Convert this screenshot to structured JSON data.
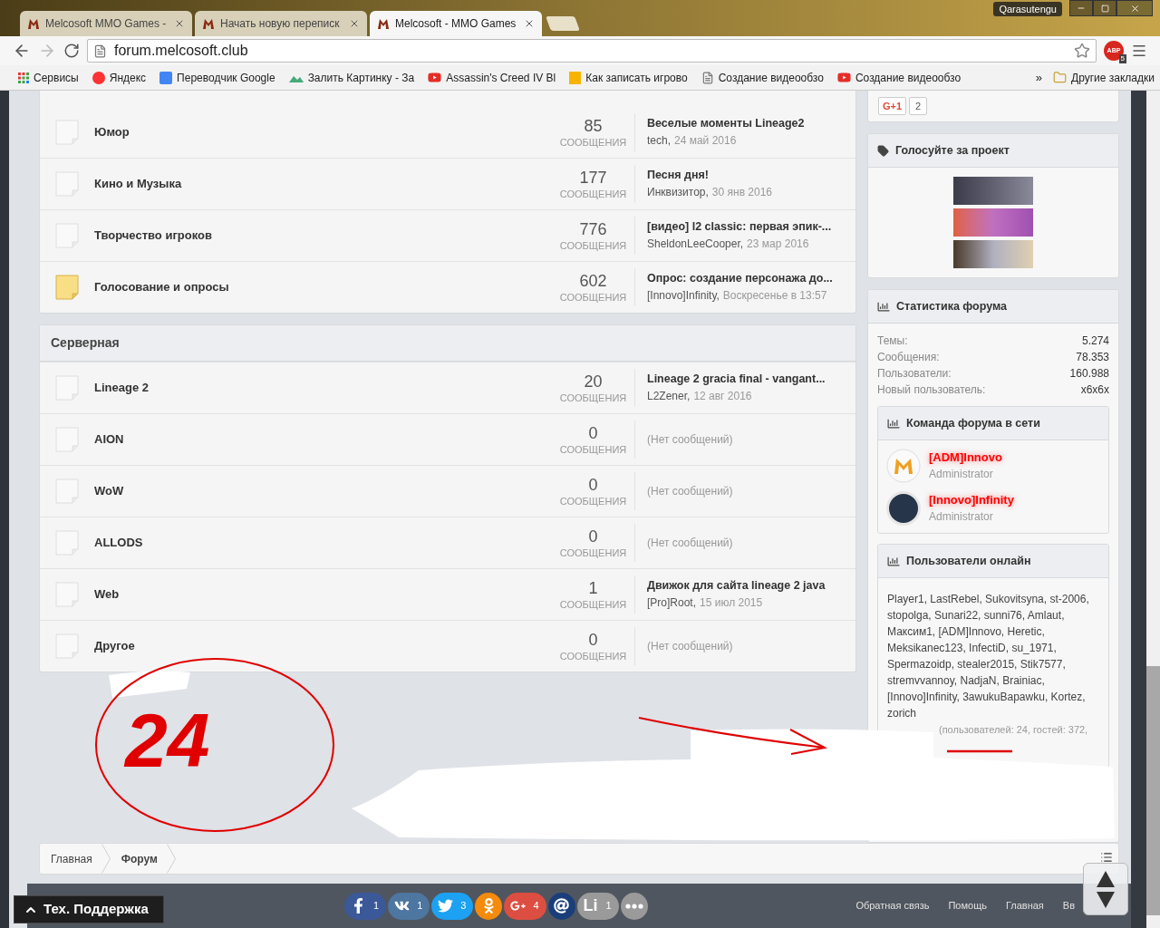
{
  "browser": {
    "tabs": [
      {
        "title": "Melcosoft MMO Games -",
        "selected": false
      },
      {
        "title": "Начать новую переписк",
        "selected": false
      },
      {
        "title": "Melcosoft - MMO Games",
        "selected": true
      }
    ],
    "profile": "Qarasutengu",
    "address": "forum.melcosoft.club",
    "extension": {
      "label": "ABP",
      "badge": "5"
    },
    "bookmarks": [
      {
        "label": "Сервисы",
        "kind": "apps"
      },
      {
        "label": "Яндекс",
        "kind": "yandex"
      },
      {
        "label": "Переводчик Google",
        "kind": "translate"
      },
      {
        "label": "Залить Картинку - За",
        "kind": "image"
      },
      {
        "label": "Assassin's Creed IV Bl",
        "kind": "youtube"
      },
      {
        "label": "Как записать игрово",
        "kind": "bookmark"
      },
      {
        "label": "Создание видеообзо",
        "kind": "page"
      },
      {
        "label": "Создание видеообзо",
        "kind": "youtube"
      }
    ],
    "more": "»",
    "other": "Другие закладки"
  },
  "sections": [
    {
      "rows": [
        {
          "name": "Юмор",
          "unread": false,
          "count": "85",
          "count_label": "СООБЩЕНИЯ",
          "last_post": {
            "title": "Веселые моменты Lineage2",
            "author": "tech,",
            "date": "24 май 2016"
          }
        },
        {
          "name": "Кино и Музыка",
          "unread": false,
          "count": "177",
          "count_label": "СООБЩЕНИЯ",
          "last_post": {
            "title": "Песня дня!",
            "author": "Инквизитор,",
            "date": "30 янв 2016"
          }
        },
        {
          "name": "Творчество игроков",
          "unread": false,
          "count": "776",
          "count_label": "СООБЩЕНИЯ",
          "last_post": {
            "title": "[видео] l2 classic: первая эпик-...",
            "author": "SheldonLeeCooper,",
            "date": "23 мар 2016"
          }
        },
        {
          "name": "Голосование и опросы",
          "unread": true,
          "count": "602",
          "count_label": "СООБЩЕНИЯ",
          "last_post": {
            "title": "Опрос: создание персонажа до...",
            "author": "[Innovo]Infinity,",
            "date": "Воскресенье в 13:57"
          }
        }
      ]
    },
    {
      "title": "Серверная",
      "rows": [
        {
          "name": "Lineage 2",
          "unread": false,
          "count": "20",
          "count_label": "СООБЩЕНИЯ",
          "last_post": {
            "title": "Lineage 2 gracia final - vangant...",
            "author": "L2Zener,",
            "date": "12 авг 2016"
          }
        },
        {
          "name": "AION",
          "unread": false,
          "count": "0",
          "count_label": "СООБЩЕНИЯ",
          "empty": "(Нет сообщений)"
        },
        {
          "name": "WoW",
          "unread": false,
          "count": "0",
          "count_label": "СООБЩЕНИЯ",
          "empty": "(Нет сообщений)"
        },
        {
          "name": "ALLODS",
          "unread": false,
          "count": "0",
          "count_label": "СООБЩЕНИЯ",
          "empty": "(Нет сообщений)"
        },
        {
          "name": "Web",
          "unread": false,
          "count": "1",
          "count_label": "СООБЩЕНИЯ",
          "last_post": {
            "title": "Движок для сайта lineage 2 java",
            "author": "[Pro]Root,",
            "date": "15 июл 2015"
          }
        },
        {
          "name": "Другое",
          "unread": false,
          "count": "0",
          "count_label": "СООБЩЕНИЯ",
          "empty": "(Нет сообщений)"
        }
      ]
    }
  ],
  "sidebar": {
    "gplus": {
      "label": "G+1",
      "count": "2"
    },
    "vote": {
      "title": "Голосуйте за проект"
    },
    "stats": {
      "title": "Статистика форума",
      "rows": [
        {
          "label": "Темы:",
          "value": "5.274"
        },
        {
          "label": "Сообщения:",
          "value": "78.353"
        },
        {
          "label": "Пользователи:",
          "value": "160.988"
        },
        {
          "label": "Новый пользователь:",
          "value": "x6x6x"
        }
      ]
    },
    "team": {
      "title": "Команда форума в сети",
      "members": [
        {
          "name": "[ADM]Innovo",
          "role": "Administrator",
          "kind": "logo"
        },
        {
          "name": "[Innovo]Infinity",
          "role": "Administrator",
          "kind": "photo"
        }
      ]
    },
    "online": {
      "title": "Пользователи онлайн",
      "users": "Player1, LastRebel, Sukovitsyna, st-2006, stopolga, Sunari22, sunni76, Amlaut, Максим1, [ADM]Innovo, Heretic, Meksikanec123, InfectiD, su_1971, Spermazoidp, stealer2015, Stik7577, stremvvannoy, NadjaN, Brainiac, [Innovo]Infinity, 3awukuBapawku, Kortez, zorich",
      "summary": "(пользователей: 24, гостей: 372,"
    }
  },
  "breadcrumb": [
    {
      "label": "Главная",
      "current": false
    },
    {
      "label": "Форум",
      "current": true
    }
  ],
  "footer": {
    "support": "Тех. Поддержка",
    "share": [
      {
        "kind": "facebook",
        "count": "1"
      },
      {
        "kind": "vk",
        "count": "1"
      },
      {
        "kind": "twitter",
        "count": "3"
      },
      {
        "kind": "ok"
      },
      {
        "kind": "gplus",
        "count": "4"
      },
      {
        "kind": "mail"
      },
      {
        "kind": "li",
        "label": "Li",
        "count": "1"
      },
      {
        "kind": "more"
      }
    ],
    "links": [
      "Обратная связь",
      "Помощь",
      "Главная",
      "Вв"
    ]
  },
  "annotation": {
    "text": "24"
  }
}
